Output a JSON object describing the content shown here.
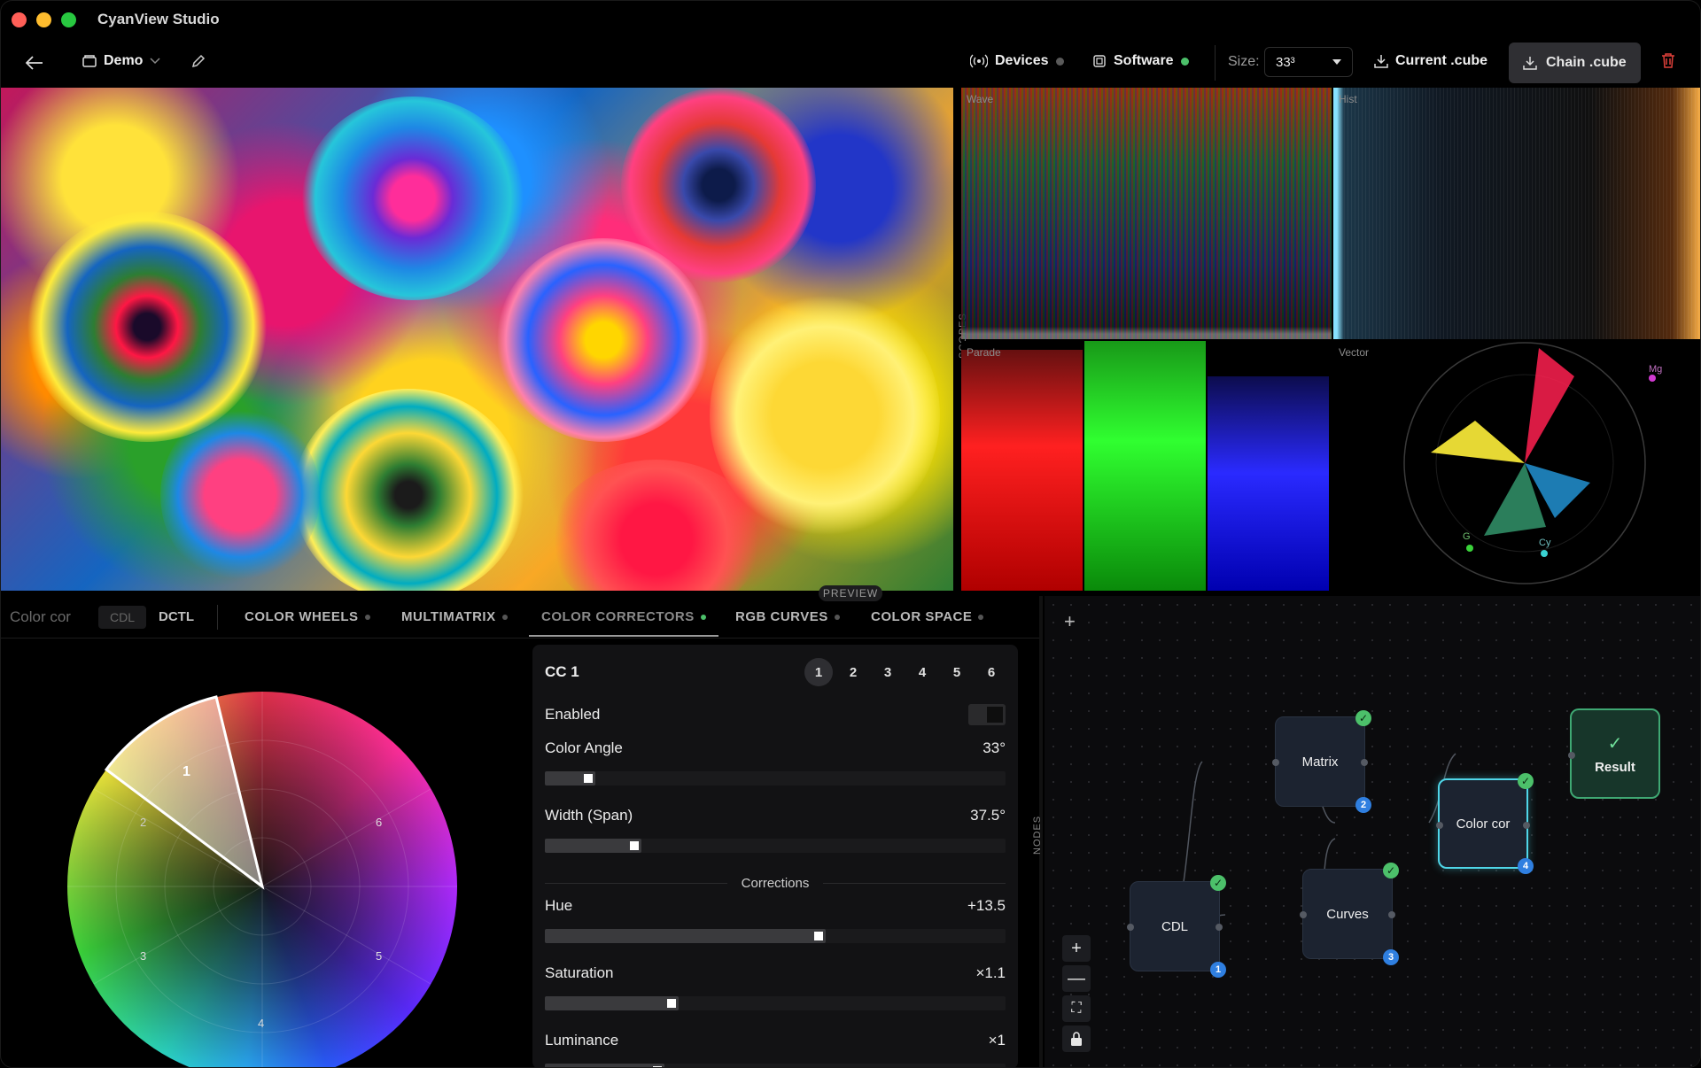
{
  "app": {
    "title": "CyanView Studio"
  },
  "toolbar": {
    "project_name": "Demo",
    "devices_label": "Devices",
    "software_label": "Software",
    "size_label": "Size:",
    "size_value": "33³",
    "current_cube_label": "Current .cube",
    "chain_cube_label": "Chain .cube",
    "colors": {
      "devices_status": "#5a5a5a",
      "software_status": "#4cc06a",
      "delete": "#e0403a"
    }
  },
  "scopes": {
    "side_tab": "SCOPES",
    "wave_label": "Wave",
    "hist_label": "Hist",
    "parade_label": "Parade",
    "vector_label": "Vector",
    "vector_marks": {
      "mg": "Mg",
      "g": "G",
      "cy": "Cy"
    }
  },
  "preview_chip": "PREVIEW",
  "panel": {
    "title": "Color cor",
    "format_tabs": [
      "CDL",
      "DCTL"
    ],
    "tabs": [
      {
        "label": "COLOR WHEELS",
        "active": false
      },
      {
        "label": "MULTIMATRIX",
        "active": false
      },
      {
        "label": "COLOR CORRECTORS",
        "active": true
      },
      {
        "label": "RGB CURVES",
        "active": false
      },
      {
        "label": "COLOR SPACE",
        "active": false
      }
    ],
    "active_color": "#4cc06a"
  },
  "wheel": {
    "segments": [
      "1",
      "2",
      "3",
      "4",
      "5",
      "6"
    ]
  },
  "cc": {
    "title": "CC 1",
    "numbers": [
      "1",
      "2",
      "3",
      "4",
      "5",
      "6"
    ],
    "selected": "1",
    "enabled_label": "Enabled",
    "color_angle": {
      "label": "Color Angle",
      "value": "33°",
      "fraction": 0.11
    },
    "width": {
      "label": "Width (Span)",
      "value": "37.5°",
      "fraction": 0.21
    },
    "corrections_label": "Corrections",
    "hue": {
      "label": "Hue",
      "value": "+13.5",
      "fraction": 0.61
    },
    "saturation": {
      "label": "Saturation",
      "value": "×1.1",
      "fraction": 0.29
    },
    "luminance": {
      "label": "Luminance",
      "value": "×1",
      "fraction": 0.26
    }
  },
  "nodes": {
    "side_tab": "NODES",
    "add": "+",
    "items": [
      {
        "label": "CDL",
        "badge": "1",
        "check": "✓"
      },
      {
        "label": "Matrix",
        "badge": "2",
        "check": "✓"
      },
      {
        "label": "Curves",
        "badge": "3",
        "check": "✓"
      },
      {
        "label": "Color cor",
        "badge": "4",
        "check": "✓"
      },
      {
        "label": "Result",
        "check": "✓"
      }
    ],
    "zoom": [
      "+",
      "—",
      "⛶",
      "🔒"
    ]
  }
}
